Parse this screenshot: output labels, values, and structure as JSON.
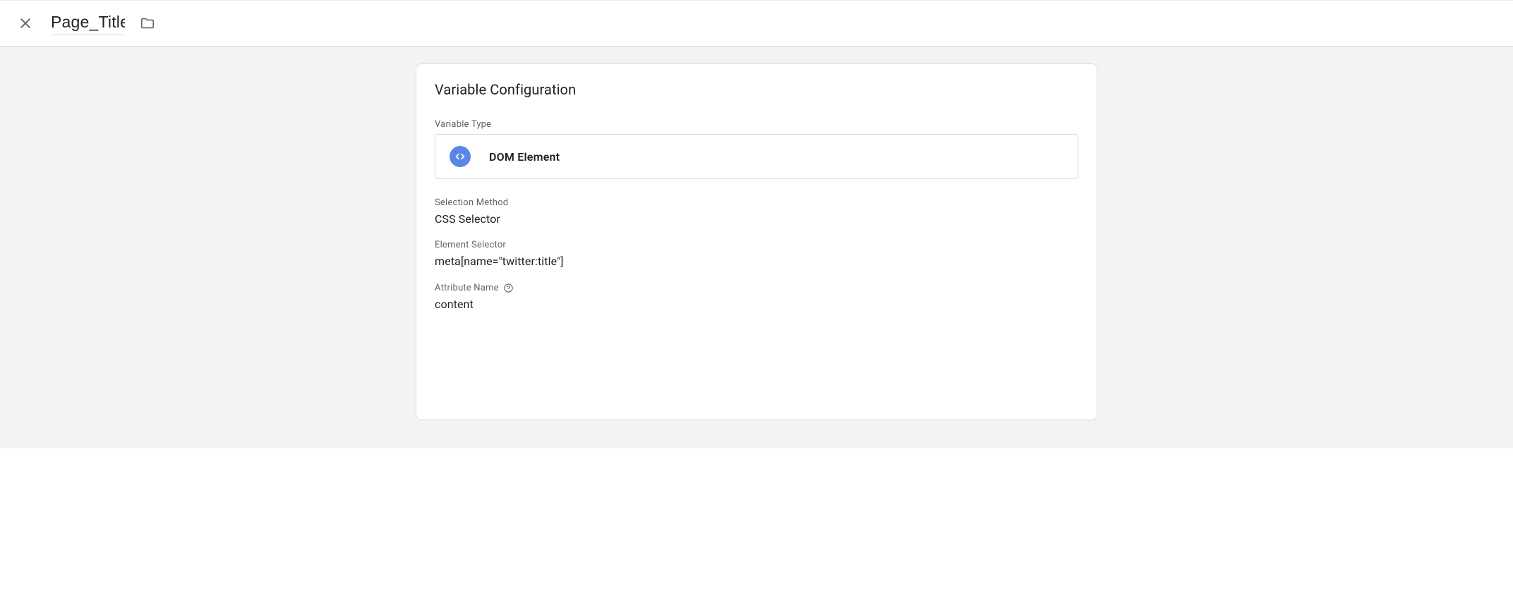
{
  "header": {
    "title_value": "Page_Title"
  },
  "card": {
    "title": "Variable Configuration",
    "variable_type_label": "Variable Type",
    "variable_type_name": "DOM Element",
    "selection_method_label": "Selection Method",
    "selection_method_value": "CSS Selector",
    "element_selector_label": "Element Selector",
    "element_selector_value": "meta[name=\"twitter:title\"]",
    "attribute_name_label": "Attribute Name",
    "attribute_name_value": "content"
  }
}
